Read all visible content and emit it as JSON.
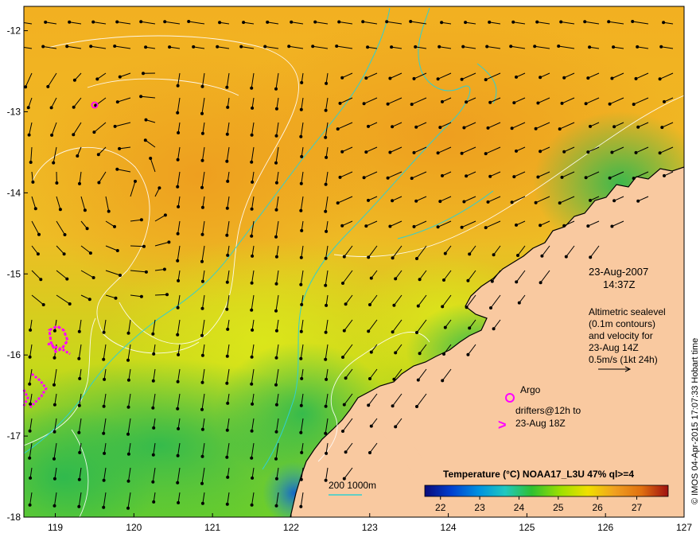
{
  "map": {
    "lon_ticks": [
      "119",
      "120",
      "121",
      "122",
      "123",
      "124",
      "125",
      "126",
      "127"
    ],
    "lat_ticks": [
      "-12",
      "-13",
      "-14",
      "-15",
      "-16",
      "-17",
      "-18"
    ],
    "lon_range": [
      118.6,
      127
    ],
    "lat_range": [
      -18,
      -11.7
    ]
  },
  "annotations": {
    "date": "23-Aug-2007",
    "time": "14:37Z",
    "altimetry_lines": [
      "Altimetric sealevel",
      "(0.1m contours)",
      "and velocity for",
      "23-Aug 14Z",
      "0.5m/s (1kt 24h)"
    ]
  },
  "legend": {
    "argo_label": "Argo",
    "drifter_line1": "drifters@12h to",
    "drifter_line2": "23-Aug 18Z",
    "drifter_marker": ">",
    "isobath_label": "200  1000m"
  },
  "colorbar": {
    "title": "Temperature (°C) NOAA17_L3U 47% ql>=4",
    "ticks": [
      "22",
      "23",
      "24",
      "25",
      "26",
      "27"
    ],
    "range": [
      21.6,
      27.8
    ],
    "colors": [
      "#0a0a7a",
      "#0040d0",
      "#0090e0",
      "#20c8c0",
      "#30c030",
      "#a0e000",
      "#f0e000",
      "#f0a020",
      "#e07010",
      "#a01010"
    ]
  },
  "credit": "© IMOS 04-Apr-2015 17:07:33 Hobart time",
  "colors": {
    "land": "#f9c9a0",
    "ocean_warm": "#f0ae23",
    "ocean_mid": "#c8dc18",
    "ocean_cool": "#3cc03c",
    "ocean_cold": "#1e78d8",
    "isobath": "#30d0d0",
    "drifter": "#ff00ff"
  }
}
